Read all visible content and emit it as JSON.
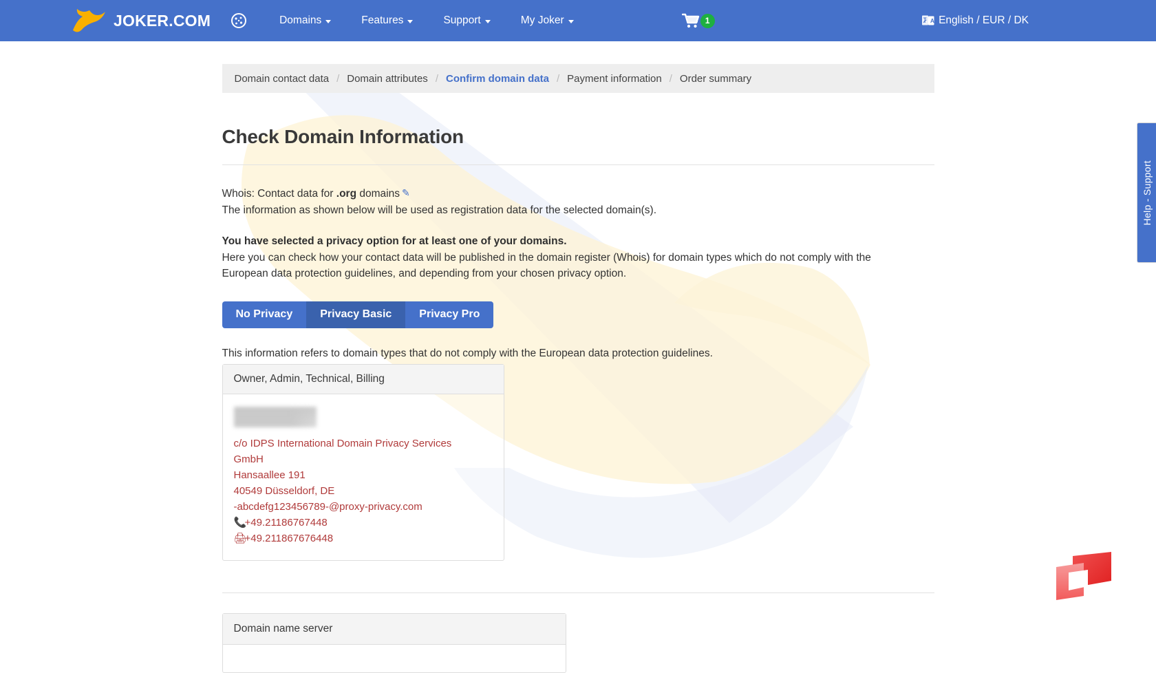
{
  "header": {
    "brand_name": "JOKER.COM",
    "dashboard_icon": "dashboard-icon",
    "nav_items": [
      {
        "label": "Domains",
        "has_caret": true
      },
      {
        "label": "Features",
        "has_caret": true
      },
      {
        "label": "Support",
        "has_caret": true
      },
      {
        "label": "My Joker",
        "has_caret": true
      }
    ],
    "cart": {
      "icon": "shopping-cart-icon",
      "badge_count": "1"
    },
    "language": {
      "icon": "translate-icon",
      "label": "English / EUR / DK"
    }
  },
  "breadcrumb": {
    "steps": [
      {
        "label": "Domain contact data",
        "active": false
      },
      {
        "label": "Domain attributes",
        "active": false
      },
      {
        "label": "Confirm domain data",
        "active": true
      },
      {
        "label": "Payment information",
        "active": false
      },
      {
        "label": "Order summary",
        "active": false
      }
    ],
    "separator": "/"
  },
  "main": {
    "title": "Check Domain Information",
    "whois_prefix": "Whois: Contact data for ",
    "whois_tld": ".org",
    "whois_suffix": " domains",
    "edit_icon": "edit-pencil-icon",
    "info_line": "The information as shown below will be used as registration data for the selected domain(s).",
    "privacy_notice_strong": "You have selected a privacy option for at least one of your domains.",
    "privacy_notice_line1": "Here you can check how your contact data will be published in the domain register (Whois) for domain types which do not comply with the",
    "privacy_notice_line2": "European data protection guidelines, and depending from your chosen privacy option.",
    "privacy_tabs": [
      {
        "label": "No Privacy",
        "active": false
      },
      {
        "label": "Privacy Basic",
        "active": true
      },
      {
        "label": "Privacy Pro",
        "active": false
      }
    ],
    "refers_line": "This information refers to domain types that do not comply with the European data protection guidelines.",
    "contact_card": {
      "header": "Owner, Admin, Technical, Billing",
      "redacted_name": "",
      "lines": [
        "c/o IDPS International Domain Privacy Services GmbH",
        "Hansaallee 191",
        "40549 Düsseldorf, DE",
        "-abcdefg123456789-@proxy-privacy.com"
      ],
      "phone_icon": "phone-icon",
      "phone": "+49.21186767448",
      "fax_icon": "fax-icon",
      "fax": "+49.211867676448"
    },
    "nameserver_card": {
      "header": "Domain name server"
    }
  },
  "side_tab": {
    "label": "Help - Support"
  },
  "colors": {
    "brand_blue": "#4571ca",
    "active_tab_blue": "#3a62ad",
    "logo_yellow": "#f9b000",
    "badge_green": "#1eb040",
    "contact_red": "#b03a3a",
    "corner_logo_red": "#ef3a3a",
    "breadcrumb_bg": "#eeeeee"
  }
}
